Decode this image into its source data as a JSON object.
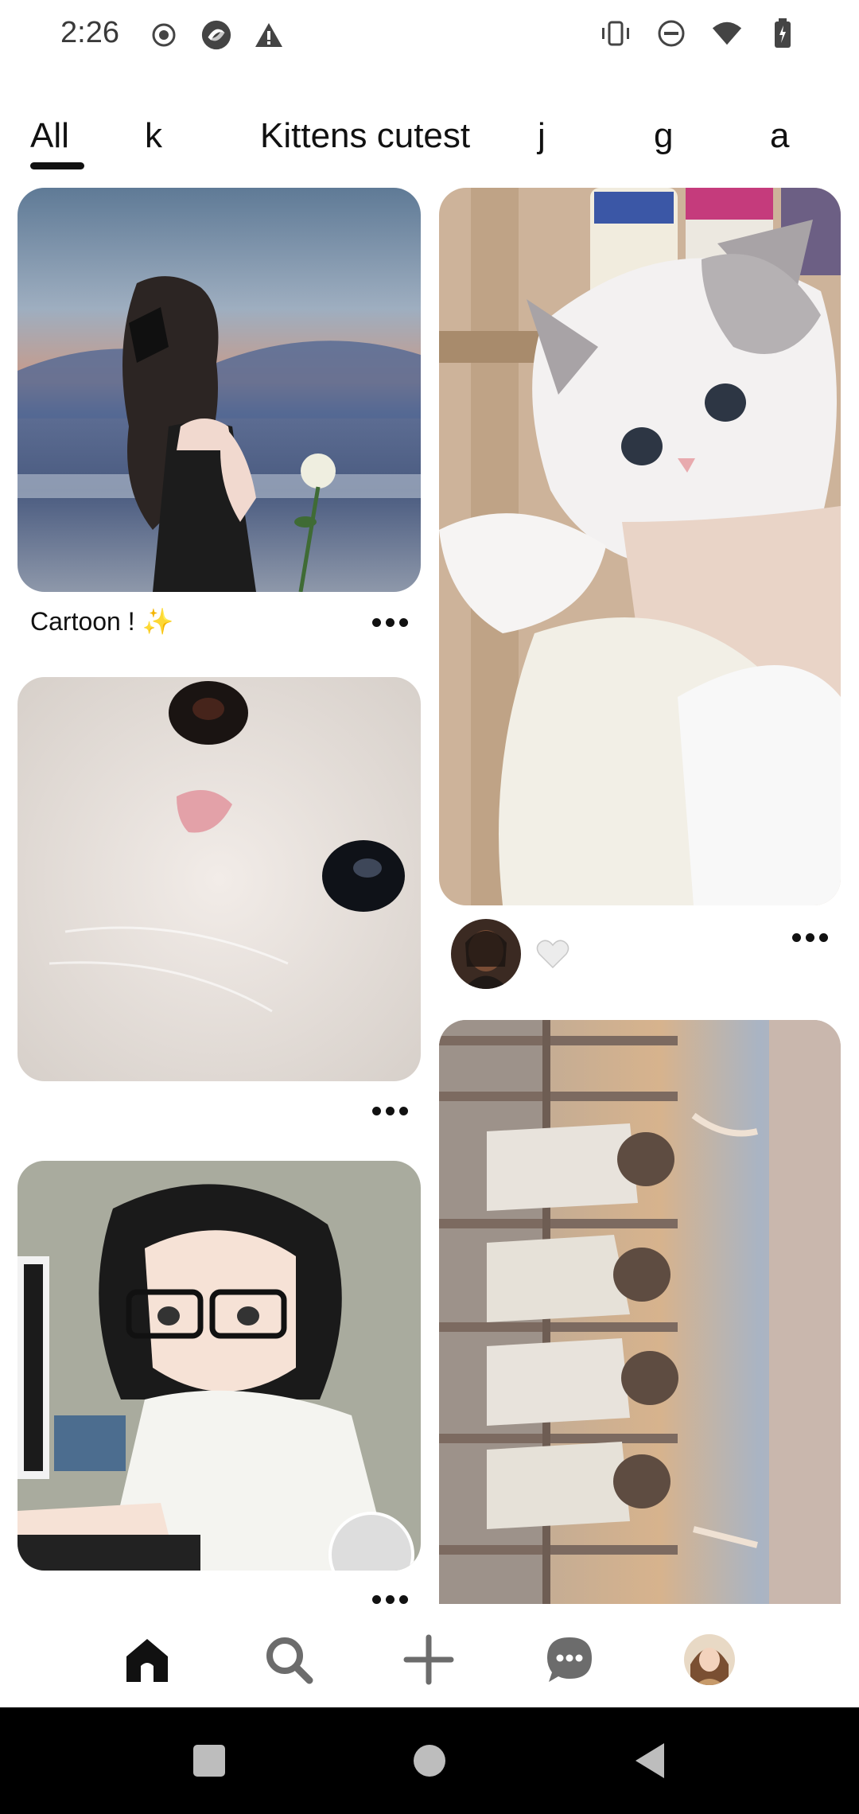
{
  "status_bar": {
    "time": "2:26",
    "icons_left": [
      "record-icon",
      "app-logo-icon",
      "warning-icon"
    ],
    "icons_right": [
      "vibrate-icon",
      "do-not-disturb-icon",
      "wifi-icon",
      "battery-icon"
    ]
  },
  "tabs": {
    "items": [
      {
        "label": "All",
        "selected": true
      },
      {
        "label": "k",
        "selected": false
      },
      {
        "label": "Kittens cutest",
        "selected": false
      },
      {
        "label": "j",
        "selected": false
      },
      {
        "label": "g",
        "selected": false
      },
      {
        "label": "a",
        "selected": false
      }
    ]
  },
  "feed": {
    "pins": [
      {
        "image": "anime-girl-at-sunset-beach",
        "caption": "Cartoon ! ✨"
      },
      {
        "image": "white-kitten-in-hand",
        "caption": ""
      },
      {
        "image": "blurry-white-cat-closeup",
        "caption": ""
      },
      {
        "image": "anime-girls-on-bridge",
        "caption": ""
      },
      {
        "image": "anime-girl-with-glasses-at-desk",
        "caption": ""
      }
    ],
    "reaction_icon": "heart-icon"
  },
  "bottom_nav": {
    "items": [
      "home-icon",
      "search-icon",
      "create-icon",
      "messages-icon",
      "profile-avatar"
    ],
    "active": "home-icon"
  },
  "system_nav": [
    "recents-button",
    "home-button",
    "back-button"
  ]
}
